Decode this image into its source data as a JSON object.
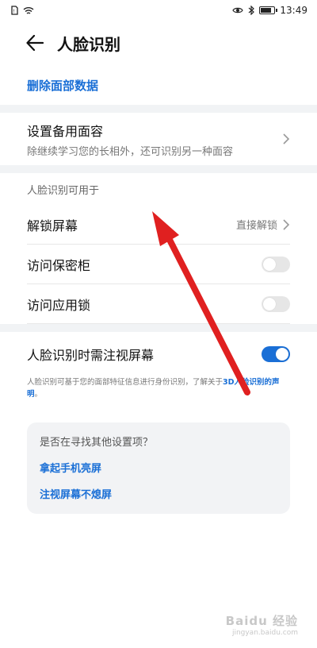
{
  "status_bar": {
    "time": "13:49"
  },
  "header": {
    "title": "人脸识别"
  },
  "delete_link": "删除面部数据",
  "backup_face": {
    "title": "设置备用面容",
    "description": "除继续学习您的长相外，还可识别另一种面容"
  },
  "usage_section": {
    "header": "人脸识别可用于",
    "unlock_label": "解锁屏幕",
    "unlock_value": "直接解锁",
    "vault_label": "访问保密柜",
    "vault_enabled": false,
    "app_lock_label": "访问应用锁",
    "app_lock_enabled": false
  },
  "gaze": {
    "label": "人脸识别时需注视屏幕",
    "enabled": true
  },
  "note": {
    "text": "人脸识别可基于您的面部特征信息进行身份识别，了解关于",
    "link": "3D人脸识别的声明",
    "end": "。"
  },
  "suggestions": {
    "title": "是否在寻找其他设置项？",
    "items": [
      "拿起手机亮屏",
      "注视屏幕不熄屏"
    ]
  },
  "watermark": {
    "main": "Baidu 经验",
    "sub": "jingyan.baidu.com"
  },
  "colors": {
    "accent": "#1a6fd6",
    "arrow": "#e02020"
  }
}
